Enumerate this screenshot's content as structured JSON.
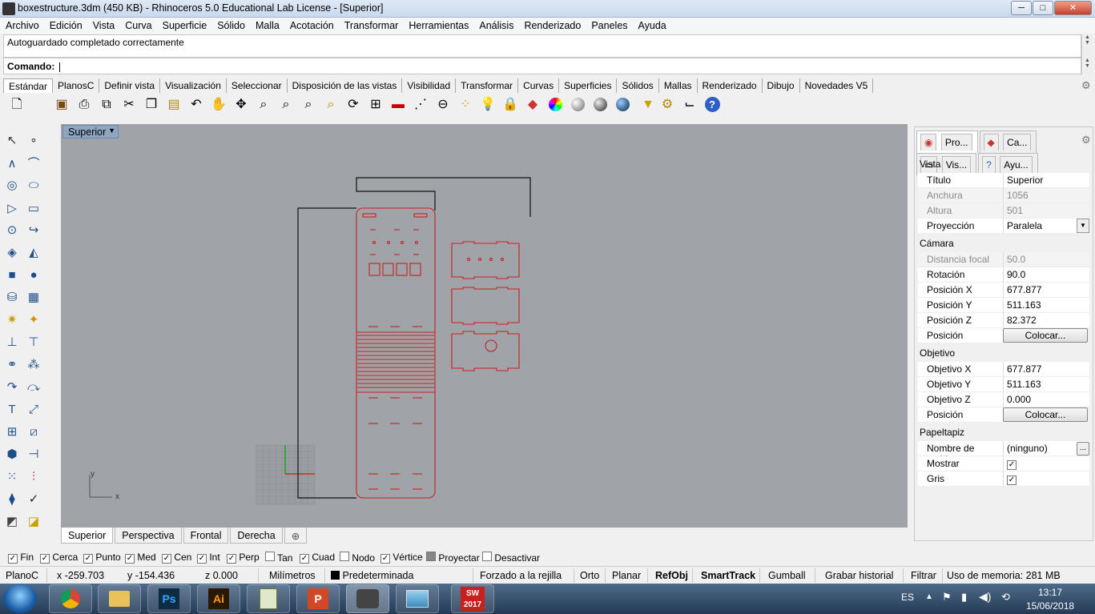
{
  "window": {
    "title": "boxestructure.3dm (450 KB) - Rhinoceros 5.0 Educational Lab License - [Superior]",
    "minimize": "─",
    "maximize": "□",
    "close": "✕"
  },
  "menu": [
    "Archivo",
    "Edición",
    "Vista",
    "Curva",
    "Superficie",
    "Sólido",
    "Malla",
    "Acotación",
    "Transformar",
    "Herramientas",
    "Análisis",
    "Renderizado",
    "Paneles",
    "Ayuda"
  ],
  "command": {
    "history": "Autoguardado completado correctamente",
    "prompt": "Comando:"
  },
  "toolbar_tabs": [
    "Estándar",
    "PlanosC",
    "Definir vista",
    "Visualización",
    "Seleccionar",
    "Disposición de las vistas",
    "Visibilidad",
    "Transformar",
    "Curvas",
    "Superficies",
    "Sólidos",
    "Mallas",
    "Renderizado",
    "Dibujo",
    "Novedades V5"
  ],
  "toolbar_icons": [
    "new-icon",
    "save-icon",
    "print-icon",
    "import-icon",
    "cut-icon",
    "copy-icon",
    "paste-icon",
    "undo-icon",
    "pan-icon",
    "rotate-view-icon",
    "zoom-icon",
    "zoom-window-icon",
    "zoom-extents-icon",
    "zoom-selected-icon",
    "rotate-icon",
    "four-views-icon",
    "car-icon",
    "grid-snap-icon",
    "cplane-icon",
    "points-icon",
    "light-icon",
    "lock-icon",
    "layer-icon",
    "color-wheel-icon",
    "sphere-shaded-icon",
    "sphere-render-icon",
    "sphere-blue-icon",
    "filter-icon",
    "options-gear-icon",
    "dimensions-icon",
    "help-icon"
  ],
  "viewport": {
    "label": "Superior",
    "axis_x": "x",
    "axis_y": "y"
  },
  "viewport_tabs": [
    "Superior",
    "Perspectiva",
    "Frontal",
    "Derecha"
  ],
  "panel": {
    "tabs": [
      "Pro...",
      "Ca...",
      "Vis...",
      "Ayu..."
    ],
    "sections": {
      "vista": "Vista",
      "camara": "Cámara",
      "objetivo": "Objetivo",
      "papeltapiz": "Papeltapiz"
    },
    "vista_rows": [
      {
        "k": "Título",
        "v": "Superior"
      },
      {
        "k": "Anchura",
        "v": "1056"
      },
      {
        "k": "Altura",
        "v": "501"
      },
      {
        "k": "Proyección",
        "v": "Paralela"
      }
    ],
    "camara_rows": [
      {
        "k": "Distancia focal",
        "v": "50.0"
      },
      {
        "k": "Rotación",
        "v": "90.0"
      },
      {
        "k": "Posición X",
        "v": "677.877"
      },
      {
        "k": "Posición Y",
        "v": "511.163"
      },
      {
        "k": "Posición Z",
        "v": "82.372"
      },
      {
        "k": "Posición",
        "v": "Colocar..."
      }
    ],
    "objetivo_rows": [
      {
        "k": "Objetivo X",
        "v": "677.877"
      },
      {
        "k": "Objetivo Y",
        "v": "511.163"
      },
      {
        "k": "Objetivo Z",
        "v": "0.000"
      },
      {
        "k": "Posición",
        "v": "Colocar..."
      }
    ],
    "papel_rows": [
      {
        "k": "Nombre de archivo",
        "v": "(ninguno)"
      },
      {
        "k": "Mostrar",
        "v": "✓"
      },
      {
        "k": "Gris",
        "v": "✓"
      }
    ]
  },
  "osnaps": [
    {
      "label": "Fin",
      "checked": "✓"
    },
    {
      "label": "Cerca",
      "checked": "✓"
    },
    {
      "label": "Punto",
      "checked": "✓"
    },
    {
      "label": "Med",
      "checked": "✓"
    },
    {
      "label": "Cen",
      "checked": "✓"
    },
    {
      "label": "Int",
      "checked": "✓"
    },
    {
      "label": "Perp",
      "checked": "✓"
    },
    {
      "label": "Tan",
      "checked": ""
    },
    {
      "label": "Cuad",
      "checked": "✓"
    },
    {
      "label": "Nodo",
      "checked": ""
    },
    {
      "label": "Vértice",
      "checked": "✓"
    },
    {
      "label": "Proyectar",
      "checked": ""
    },
    {
      "label": "Desactivar",
      "checked": ""
    }
  ],
  "status": {
    "plane": "PlanoC",
    "x": "x -259.703",
    "y": "y -154.436",
    "z": "z 0.000",
    "units": "Milímetros",
    "layer": "Predeterminada",
    "grid_snap": "Forzado a la rejilla",
    "ortho": "Orto",
    "planar": "Planar",
    "refobj": "RefObj",
    "smarttrack": "SmartTrack",
    "gumball": "Gumball",
    "history": "Grabar historial",
    "filter": "Filtrar",
    "memory": "Uso de memoria: 281 MB"
  },
  "taskbar": {
    "apps": [
      "start-orb",
      "chrome",
      "explorer",
      "Ps",
      "Ai",
      "notepad",
      "powerpoint",
      "rhino",
      "photos",
      "SW 2017"
    ],
    "lang": "ES",
    "time": "13:17",
    "date": "15/06/2018"
  }
}
